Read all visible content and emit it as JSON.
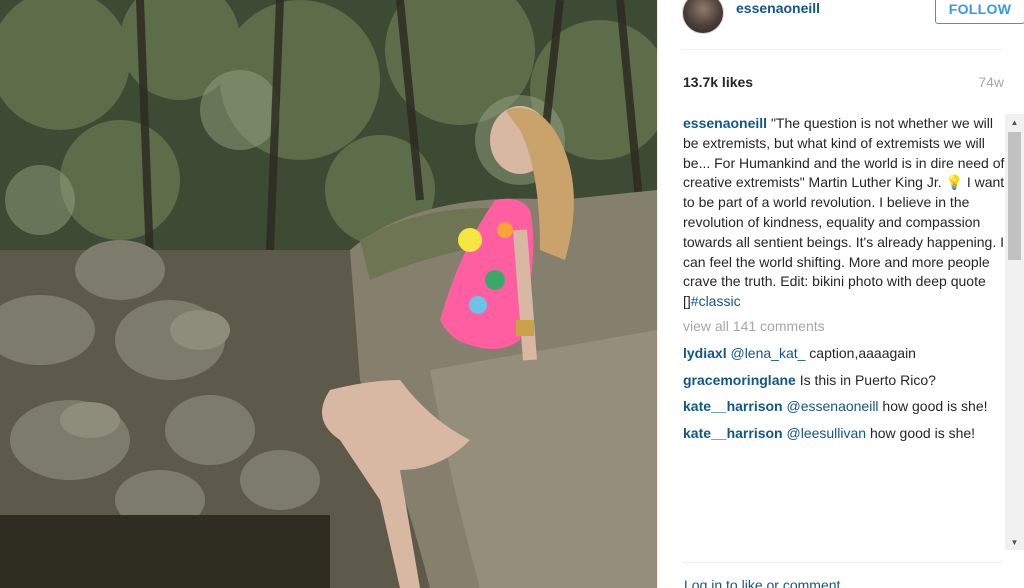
{
  "header": {
    "username": "essenaoneill",
    "follow_label": "FOLLOW"
  },
  "stats": {
    "likes": "13.7k likes",
    "time": "74w"
  },
  "caption": {
    "username": "essenaoneill",
    "text": "\"The question is not whether we will be extremists, but what kind of extremists we will be... For Humankind and the world is in dire need of creative extremists\" Martin Luther King Jr. 💡 I want to be part of a world revolution. I believe in the revolution of kindness, equality and compassion towards all sentient beings. It's already happening. I can feel the world shifting. More and more people crave the truth. Edit: bikini photo with deep quote []",
    "hashtag": "#classic"
  },
  "view_all_label": "view all 141 comments",
  "comments": [
    {
      "username": "lydiaxl",
      "mention": "@lena_kat_",
      "text": " caption,aaaagain"
    },
    {
      "username": "gracemoringlane",
      "mention": "",
      "text": "Is this in Puerto Rico?"
    },
    {
      "username": "kate__harrison",
      "mention": "@essenaoneill",
      "text": " how good is she!"
    },
    {
      "username": "kate__harrison",
      "mention": "@leesullivan",
      "text": " how good is she!"
    }
  ],
  "footer": {
    "login_label": "Log in to like or comment."
  },
  "colors": {
    "link": "#125688",
    "follow": "#3897f0",
    "muted": "#a5a7aa"
  }
}
